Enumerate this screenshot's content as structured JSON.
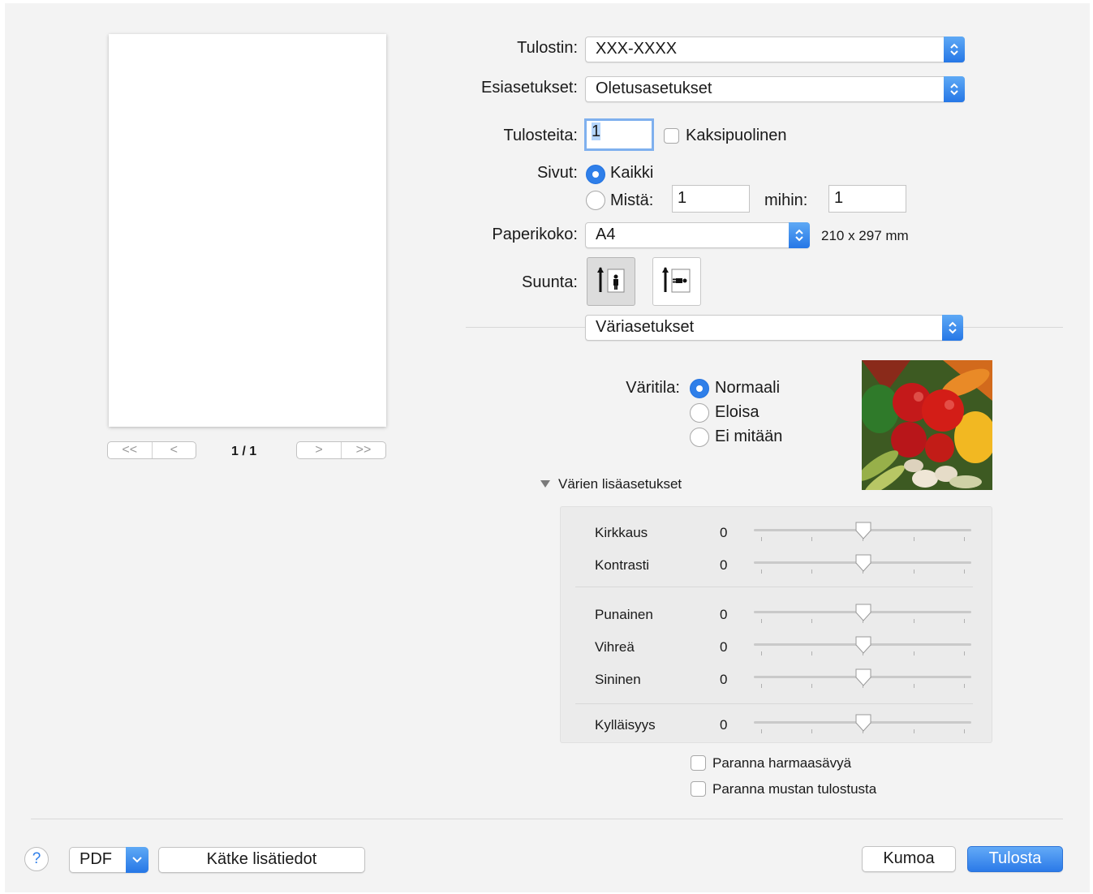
{
  "print": {
    "printer_label": "Tulostin:",
    "printer_value": "XXX-XXXX",
    "presets_label": "Esiasetukset:",
    "presets_value": "Oletusasetukset",
    "copies_label": "Tulosteita:",
    "copies_value": "1",
    "duplex_label": "Kaksipuolinen",
    "pages_label": "Sivut:",
    "pages_all": "Kaikki",
    "pages_from": "Mistä:",
    "pages_from_value": "1",
    "pages_to": "mihin:",
    "pages_to_value": "1",
    "paper_label": "Paperikoko:",
    "paper_value": "A4",
    "paper_dims": "210 x 297 mm",
    "orientation_label": "Suunta:",
    "section_value": "Väriasetukset"
  },
  "preview": {
    "page_indicator": "1 / 1",
    "nav_first": "<<",
    "nav_prev": "<",
    "nav_next": ">",
    "nav_last": ">>"
  },
  "color": {
    "mode_label": "Väritila:",
    "modes": [
      "Normaali",
      "Eloisa",
      "Ei mitään"
    ],
    "selected_mode": "Normaali",
    "advanced_label": "Värien lisäasetukset",
    "sliders": [
      {
        "name": "Kirkkaus",
        "value": "0"
      },
      {
        "name": "Kontrasti",
        "value": "0"
      },
      {
        "name": "Punainen",
        "value": "0"
      },
      {
        "name": "Vihreä",
        "value": "0"
      },
      {
        "name": "Sininen",
        "value": "0"
      },
      {
        "name": "Kylläisyys",
        "value": "0"
      }
    ],
    "enhance_gray": "Paranna harmaasävyä",
    "enhance_black": "Paranna mustan tulostusta"
  },
  "footer": {
    "help": "?",
    "pdf": "PDF",
    "hide_details": "Kätke lisätiedot",
    "cancel": "Kumoa",
    "print": "Tulosta"
  },
  "colors": {
    "accent": "#2f7fe9",
    "dialog_bg": "#f3f3f3"
  }
}
